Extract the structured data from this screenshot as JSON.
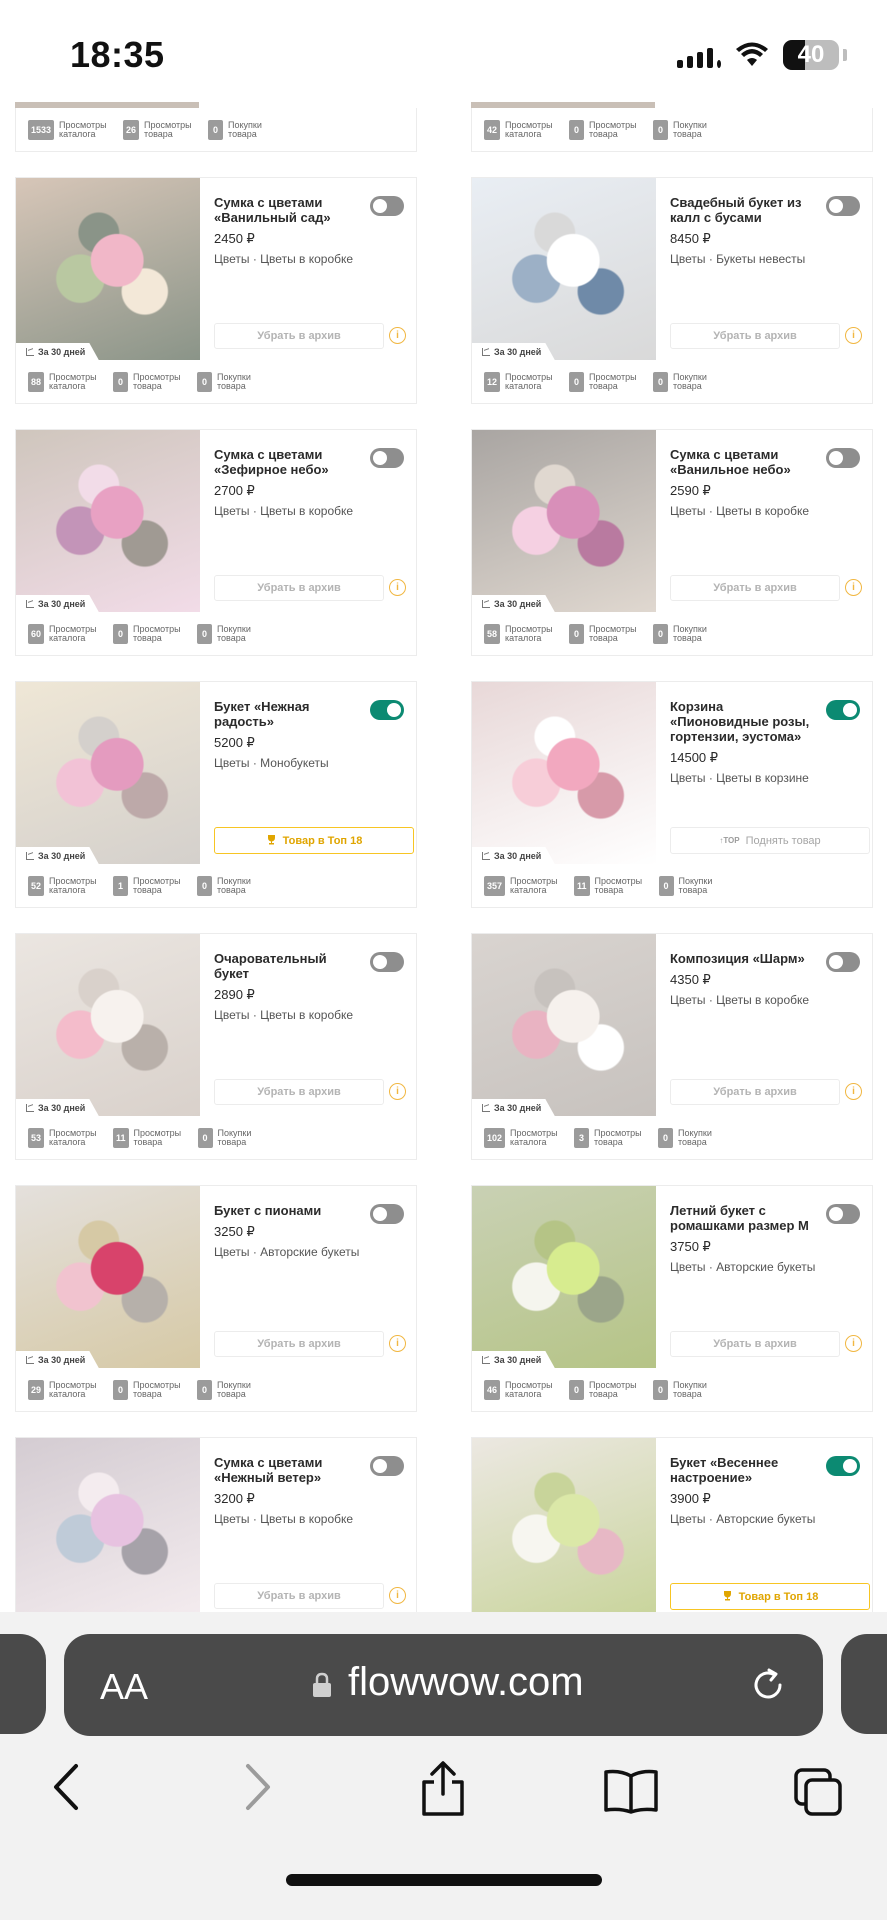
{
  "status": {
    "time": "18:35",
    "battery": "40"
  },
  "period_label": "За 30 дней",
  "stat_labels": {
    "catalog": "Просмотры каталога",
    "product": "Просмотры товара",
    "purchases": "Покупки товара"
  },
  "buttons": {
    "archive": "Убрать в архив",
    "top": "Товар в Топ 18",
    "raise": "Поднять товар",
    "top_tag": "TOP"
  },
  "top_partial": [
    {
      "catalog": "1533",
      "product": "26",
      "purchases": "0"
    },
    {
      "catalog": "42",
      "product": "0",
      "purchases": "0"
    }
  ],
  "cards": [
    {
      "title": "Сумка с цветами «Ванильный сад»",
      "price": "2450 ₽",
      "category": "Цветы · Цветы в коробке",
      "toggle": "off",
      "action": "archive",
      "stats": {
        "catalog": "88",
        "product": "0",
        "purchases": "0"
      }
    },
    {
      "title": "Свадебный букет из калл с бусами",
      "price": "8450 ₽",
      "category": "Цветы · Букеты невесты",
      "toggle": "off",
      "action": "archive",
      "stats": {
        "catalog": "12",
        "product": "0",
        "purchases": "0"
      }
    },
    {
      "title": "Сумка с цветами «Зефирное небо»",
      "price": "2700 ₽",
      "category": "Цветы · Цветы в коробке",
      "toggle": "off",
      "action": "archive",
      "stats": {
        "catalog": "60",
        "product": "0",
        "purchases": "0"
      }
    },
    {
      "title": "Сумка с цветами «Ванильное небо»",
      "price": "2590 ₽",
      "category": "Цветы · Цветы в коробке",
      "toggle": "off",
      "action": "archive",
      "stats": {
        "catalog": "58",
        "product": "0",
        "purchases": "0"
      }
    },
    {
      "title": "Букет «Нежная радость»",
      "price": "5200 ₽",
      "category": "Цветы · Монобукеты",
      "toggle": "on",
      "action": "top",
      "stats": {
        "catalog": "52",
        "product": "1",
        "purchases": "0"
      }
    },
    {
      "title": "Корзина «Пионовидные розы, гортензии, эустома»",
      "price": "14500 ₽",
      "category": "Цветы · Цветы в корзине",
      "toggle": "on",
      "action": "raise",
      "stats": {
        "catalog": "357",
        "product": "11",
        "purchases": "0"
      }
    },
    {
      "title": "Очаровательный букет",
      "price": "2890 ₽",
      "category": "Цветы · Цветы в коробке",
      "toggle": "off",
      "action": "archive",
      "stats": {
        "catalog": "53",
        "product": "11",
        "purchases": "0"
      }
    },
    {
      "title": "Композиция «Шарм»",
      "price": "4350 ₽",
      "category": "Цветы · Цветы в коробке",
      "toggle": "off",
      "action": "archive",
      "stats": {
        "catalog": "102",
        "product": "3",
        "purchases": "0"
      }
    },
    {
      "title": "Букет с пионами",
      "price": "3250 ₽",
      "category": "Цветы · Авторские букеты",
      "toggle": "off",
      "action": "archive",
      "stats": {
        "catalog": "29",
        "product": "0",
        "purchases": "0"
      }
    },
    {
      "title": "Летний букет с ромашками размер M",
      "price": "3750 ₽",
      "category": "Цветы · Авторские букеты",
      "toggle": "off",
      "action": "archive",
      "stats": {
        "catalog": "46",
        "product": "0",
        "purchases": "0"
      }
    },
    {
      "title": "Сумка с цветами «Нежный ветер»",
      "price": "3200 ₽",
      "category": "Цветы · Цветы в коробке",
      "toggle": "off",
      "action": "archive",
      "stats": null
    },
    {
      "title": "Букет «Весеннее настроение»",
      "price": "3900 ₽",
      "category": "Цветы · Авторские букеты",
      "toggle": "on",
      "action": "top",
      "stats": null
    }
  ],
  "browser": {
    "aa_label": "AA",
    "url": "flowwow.com"
  },
  "colors": {
    "accent_green": "#0c8a72",
    "top_yellow": "#f7c523",
    "toggle_off": "#8e8e8e"
  }
}
